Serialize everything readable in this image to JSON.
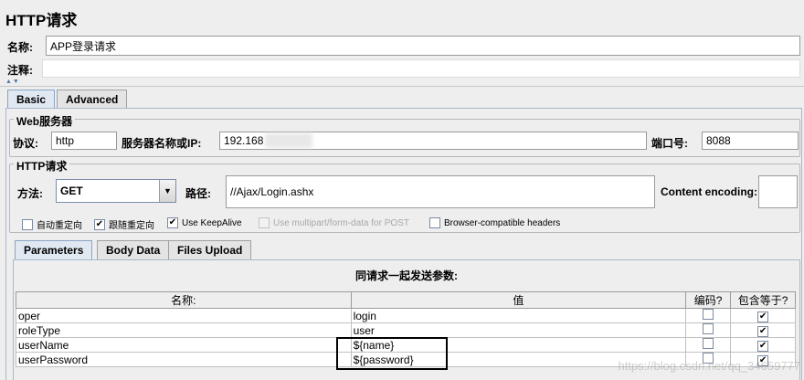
{
  "header": {
    "title": "HTTP请求",
    "name_label": "名称:",
    "name_value": "APP登录请求",
    "comment_label": "注释:",
    "comment_value": ""
  },
  "tabs": [
    {
      "label": "Basic",
      "active": true
    },
    {
      "label": "Advanced",
      "active": false
    }
  ],
  "web_server": {
    "group_title": "Web服务器",
    "protocol_label": "协议:",
    "protocol_value": "http",
    "server_label": "服务器名称或IP:",
    "server_value": "192.168",
    "port_label": "端口号:",
    "port_value": "8088"
  },
  "http_request": {
    "group_title": "HTTP请求",
    "method_label": "方法:",
    "method_value": "GET",
    "path_label": "路径:",
    "path_value": "//Ajax/Login.ashx",
    "encoding_label": "Content encoding:",
    "encoding_value": ""
  },
  "options": [
    {
      "label": "自动重定向",
      "checked": false,
      "disabled": false
    },
    {
      "label": "跟随重定向",
      "checked": true,
      "disabled": false
    },
    {
      "label": "Use KeepAlive",
      "checked": true,
      "disabled": false
    },
    {
      "label": "Use multipart/form-data for POST",
      "checked": false,
      "disabled": true
    },
    {
      "label": "Browser-compatible headers",
      "checked": false,
      "disabled": false
    }
  ],
  "sub_tabs": [
    {
      "label": "Parameters",
      "active": true
    },
    {
      "label": "Body Data",
      "active": false
    },
    {
      "label": "Files Upload",
      "active": false
    }
  ],
  "params": {
    "caption": "同请求一起发送参数:",
    "columns": [
      "名称:",
      "值",
      "编码?",
      "包含等于?"
    ],
    "rows": [
      {
        "name": "oper",
        "value": "login",
        "encode": false,
        "include_equals": true
      },
      {
        "name": "roleType",
        "value": "user",
        "encode": false,
        "include_equals": true
      },
      {
        "name": "userName",
        "value": "${name}",
        "encode": false,
        "include_equals": true
      },
      {
        "name": "userPassword",
        "value": "${password}",
        "encode": false,
        "include_equals": true
      }
    ]
  },
  "watermark": "https://blog.csdn.net/qq_34659777"
}
